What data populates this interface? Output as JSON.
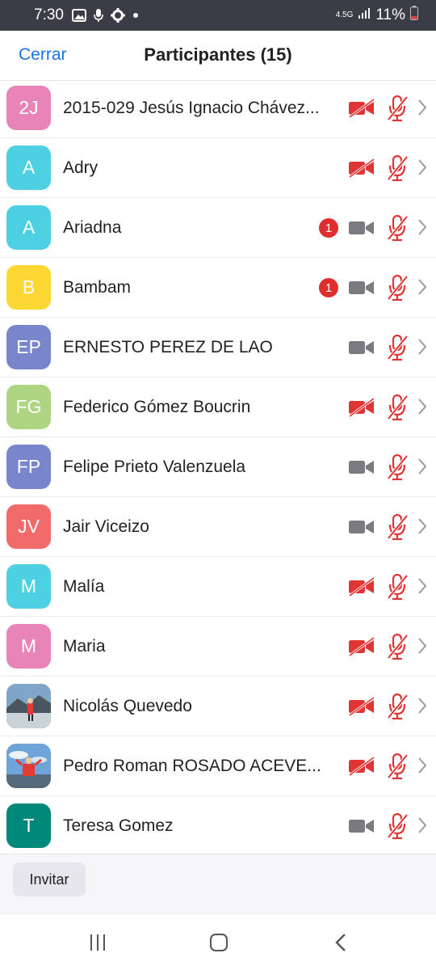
{
  "status_bar": {
    "time": "7:30",
    "icons": [
      "image-icon",
      "mic-icon",
      "gear-icon",
      "dot-icon"
    ],
    "network": "4.5G",
    "battery": "11%",
    "battery_color": "#e04444"
  },
  "header": {
    "close_label": "Cerrar",
    "title": "Participantes (15)"
  },
  "colors": {
    "accent": "#1a73e8",
    "muted_red": "#e03535",
    "neutral_icon": "#7a7a80",
    "badge_red": "#e02d2d"
  },
  "participants": [
    {
      "initials": "2J",
      "name": "2015-029 Jesús Ignacio Chávez...",
      "avatar_color": "#e884b8",
      "video_off": true,
      "mic_muted": true,
      "badge": ""
    },
    {
      "initials": "A",
      "name": "Adry",
      "avatar_color": "#4dd0e1",
      "video_off": true,
      "mic_muted": true,
      "badge": ""
    },
    {
      "initials": "A",
      "name": "Ariadna",
      "avatar_color": "#4dd0e1",
      "video_off": false,
      "mic_muted": true,
      "badge": "1"
    },
    {
      "initials": "B",
      "name": "Bambam",
      "avatar_color": "#fdd835",
      "video_off": false,
      "mic_muted": true,
      "badge": "1"
    },
    {
      "initials": "EP",
      "name": "ERNESTO PEREZ DE LAO",
      "avatar_color": "#7986cb",
      "video_off": false,
      "mic_muted": true,
      "badge": ""
    },
    {
      "initials": "FG",
      "name": "Federico Gómez Boucrin",
      "avatar_color": "#aed581",
      "video_off": true,
      "mic_muted": true,
      "badge": ""
    },
    {
      "initials": "FP",
      "name": "Felipe Prieto Valenzuela",
      "avatar_color": "#7986cb",
      "video_off": false,
      "mic_muted": true,
      "badge": ""
    },
    {
      "initials": "JV",
      "name": "Jair Viceizo",
      "avatar_color": "#f26b6b",
      "video_off": false,
      "mic_muted": true,
      "badge": ""
    },
    {
      "initials": "M",
      "name": "Malía",
      "avatar_color": "#4dd0e1",
      "video_off": true,
      "mic_muted": true,
      "badge": ""
    },
    {
      "initials": "M",
      "name": "Maria",
      "avatar_color": "#e884b8",
      "video_off": true,
      "mic_muted": true,
      "badge": ""
    },
    {
      "initials": "",
      "name": "Nicolás Quevedo",
      "avatar_color": "#5b7fa6",
      "avatar_photo": "mountain-photo",
      "video_off": true,
      "mic_muted": true,
      "badge": ""
    },
    {
      "initials": "",
      "name": "Pedro Roman ROSADO ACEVE...",
      "avatar_color": "#6fa4d8",
      "avatar_photo": "sky-photo",
      "video_off": true,
      "mic_muted": true,
      "badge": ""
    },
    {
      "initials": "T",
      "name": "Teresa Gomez",
      "avatar_color": "#00897b",
      "video_off": false,
      "mic_muted": true,
      "badge": ""
    }
  ],
  "footer": {
    "invite_label": "Invitar"
  },
  "nav": {
    "icons": [
      "recent-apps-icon",
      "home-icon",
      "back-icon"
    ]
  }
}
